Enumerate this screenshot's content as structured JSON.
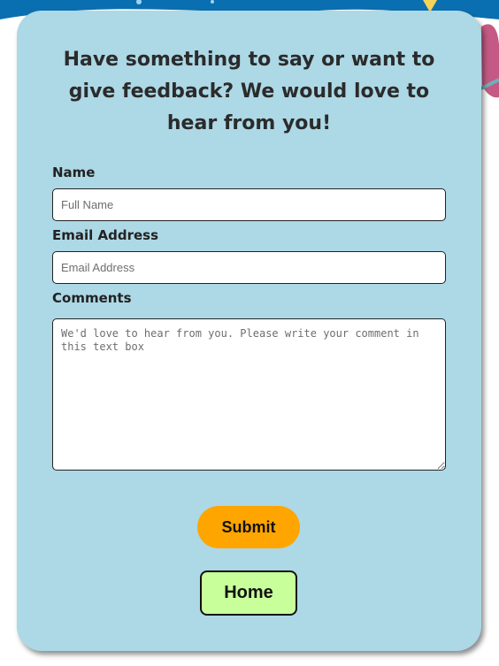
{
  "page": {
    "heading": "Have something to say or want to give feedback? We would love to hear from you!"
  },
  "form": {
    "name_label": "Name",
    "name_placeholder": "Full Name",
    "email_label": "Email Address",
    "email_placeholder": "Email Address",
    "comments_label": "Comments",
    "comments_placeholder": "We'd love to hear from you. Please write your comment in this text box",
    "submit_label": "Submit",
    "home_label": "Home"
  },
  "colors": {
    "card_background": "#add8e6",
    "submit_button": "#ffa500",
    "home_button": "#c8ff9a",
    "background_top": "#0a6fb0"
  }
}
